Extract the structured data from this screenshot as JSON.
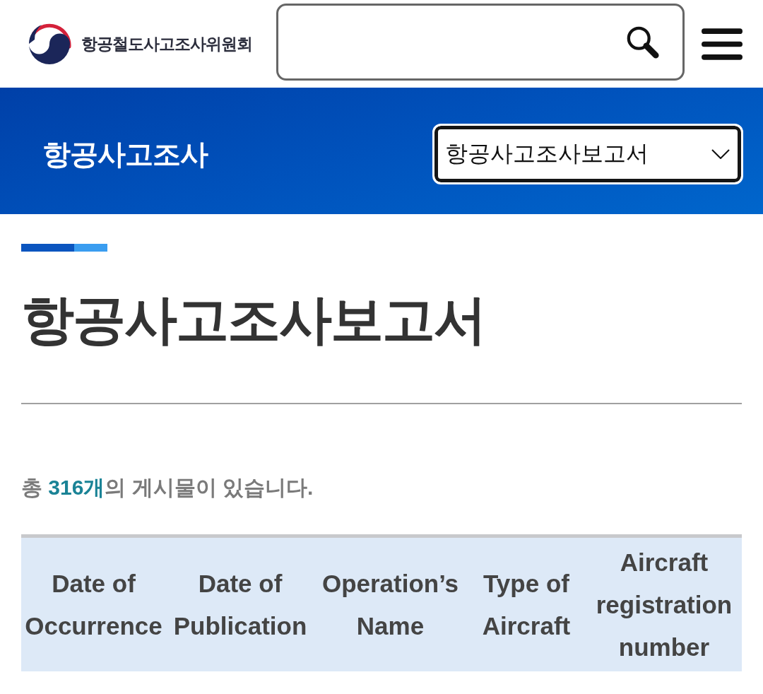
{
  "header": {
    "site_name": "항공철도사고조사위원회"
  },
  "banner": {
    "title": "항공사고조사",
    "select": {
      "value": "항공사고조사보고서"
    }
  },
  "page": {
    "title": "항공사고조사보고서",
    "count_text": {
      "before": "총",
      "count": "316개",
      "after": "의 게시물이 있습니다."
    }
  },
  "table": {
    "columns": [
      "Date of Occurrence",
      "Date of Publication",
      "Operation’s Name",
      "Type of Aircraft",
      "Aircraft registration number"
    ]
  }
}
